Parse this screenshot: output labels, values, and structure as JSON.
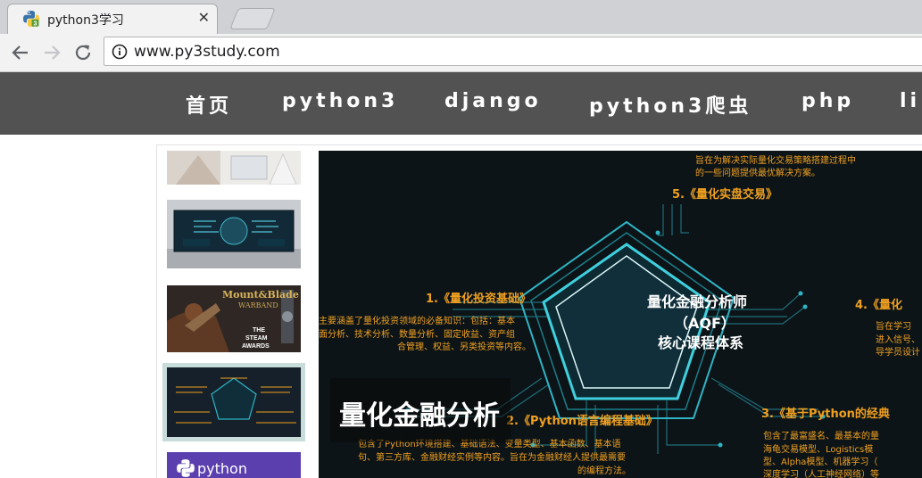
{
  "browser": {
    "tab_title": "python3学习",
    "tab_close": "✕",
    "url": "www.py3study.com"
  },
  "site_nav": {
    "items": [
      "首页",
      "python3",
      "django",
      "python3爬虫",
      "php",
      "li"
    ]
  },
  "thumbnails": [
    {
      "name": "thumb-office-photo"
    },
    {
      "name": "thumb-control-room"
    },
    {
      "name": "thumb-mount-blade"
    },
    {
      "name": "thumb-quant-finance"
    },
    {
      "name": "thumb-python-logo",
      "label": "python"
    }
  ],
  "mount_blade": {
    "title": "Mount&Blade",
    "sub": "WARBAND",
    "award1": "THE",
    "award2": "STEAM",
    "award3": "AWARDS"
  },
  "banner": {
    "caption": "量化金融分析",
    "center_line1": "量化金融分析师",
    "center_line2": "（AQF）",
    "center_line3": "核心课程体系",
    "top_desc1": "旨在为解决实际量化交易策略搭建过程中",
    "top_desc2": "的一些问题提供最优解决方案。",
    "item5": "5.《量化实盘交易》",
    "item1": "1.《量化投资基础》",
    "item1_desc1": "主要涵盖了量化投资领域的必备知识：包括：基本",
    "item1_desc2": "面分析、技术分析、数量分析、固定收益、资产组",
    "item1_desc3": "合管理、权益、另类投资等内容。",
    "item4": "4.《量化",
    "item4_desc1": "旨在学习",
    "item4_desc2": "进入信号、",
    "item4_desc3": "导学员设计",
    "item2": "2.《Python语言编程基础》",
    "item2_desc1": "包含了Python环境搭建、基础语法、变量类型、基本函数、基本语",
    "item2_desc2": "句、第三方库、金融财经实例等内容。旨在为金融财经人提供最需要",
    "item2_desc3": "的编程方法。",
    "item3": "3.《基于Python的经典",
    "item3_desc1": "包含了最富盛名、最基本的量",
    "item3_desc2": "海龟交易模型、Logistics模",
    "item3_desc3": "型、Alpha模型、机器学习（",
    "item3_desc4": "深度学习（人工神经网络）等"
  },
  "colors": {
    "nav_bg": "#525252",
    "banner_bg": "#0c1418",
    "accent_orange": "#f0a020",
    "accent_teal": "#2fb4c4",
    "selected_thumb_border": "#c8ddd9"
  }
}
